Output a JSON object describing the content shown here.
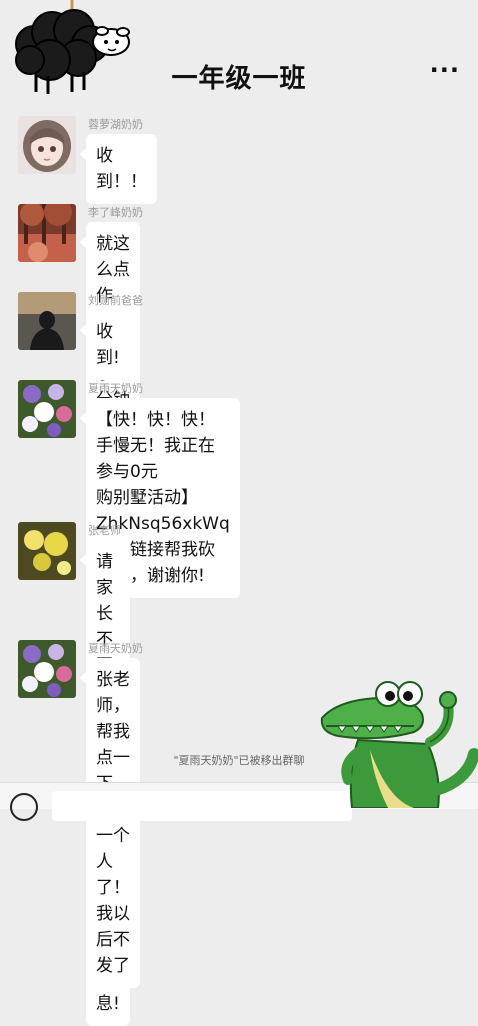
{
  "header": {
    "title": "一年级一班",
    "more_label": "···"
  },
  "messages": [
    {
      "sender": "蓉萝湖奶奶",
      "text": "收到！！",
      "avatar": "girl-avatar"
    },
    {
      "sender": "李了峰奶奶",
      "text": "就这么点作业，我孙子一分钟就做完了",
      "avatar": "autumn-trees-avatar"
    },
    {
      "sender": "刘勋前爸爸",
      "text": "收到!",
      "avatar": "silhouette-avatar"
    },
    {
      "sender": "夏雨天奶奶",
      "text": "【快！快！快！手慢无！我正在参与0元\n购别墅活动】ZhkNsq56xkWq\n点击链接帮我砍一刀，谢谢你!",
      "avatar": "flowers-avatar"
    },
    {
      "sender": "张老师",
      "text": "请家长不要在班级群里发乱七八糟\n的信息!",
      "avatar": "yellow-flowers-avatar"
    },
    {
      "sender": "夏雨天奶奶",
      "text": "张老师，帮我点一下，就差一个人\n了！我以后不发了",
      "avatar": "flowers-avatar"
    }
  ],
  "system_notice": "\"夏雨天奶奶\"已被移出群聊",
  "colors": {
    "background": "#ededed",
    "bubble": "#ffffff",
    "sender": "#9a9a9a"
  }
}
